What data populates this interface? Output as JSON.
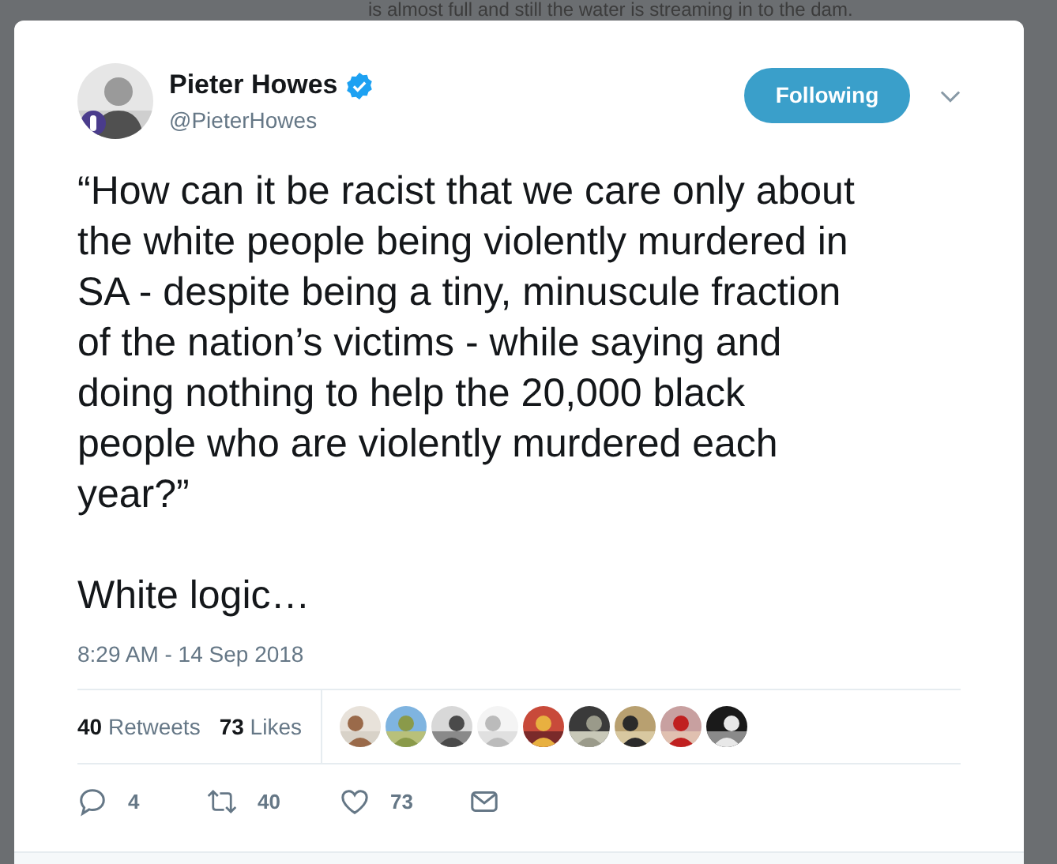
{
  "background": {
    "text": "is almost full and still the water is streaming in to the dam."
  },
  "tweet": {
    "author": {
      "name": "Pieter Howes",
      "handle": "@PieterHowes",
      "verified": true
    },
    "follow_button": {
      "label": "Following",
      "selected": true
    },
    "text": "“How can it be racist that we care only about\nthe white people being violently murdered in\nSA - despite being a tiny, minuscule fraction\nof the nation’s victims - while saying and\ndoing nothing to help the 20,000 black\npeople who are violently murdered each\nyear?”\n\nWhite logic…",
    "timestamp": "8:29 AM - 14 Sep 2018",
    "stats": [
      {
        "count": "40",
        "label": "Retweets"
      },
      {
        "count": "73",
        "label": "Likes"
      }
    ],
    "actions": [
      {
        "kind": "reply",
        "count": "4"
      },
      {
        "kind": "retweet",
        "count": "40"
      },
      {
        "kind": "like",
        "count": "73"
      },
      {
        "kind": "message"
      }
    ]
  }
}
